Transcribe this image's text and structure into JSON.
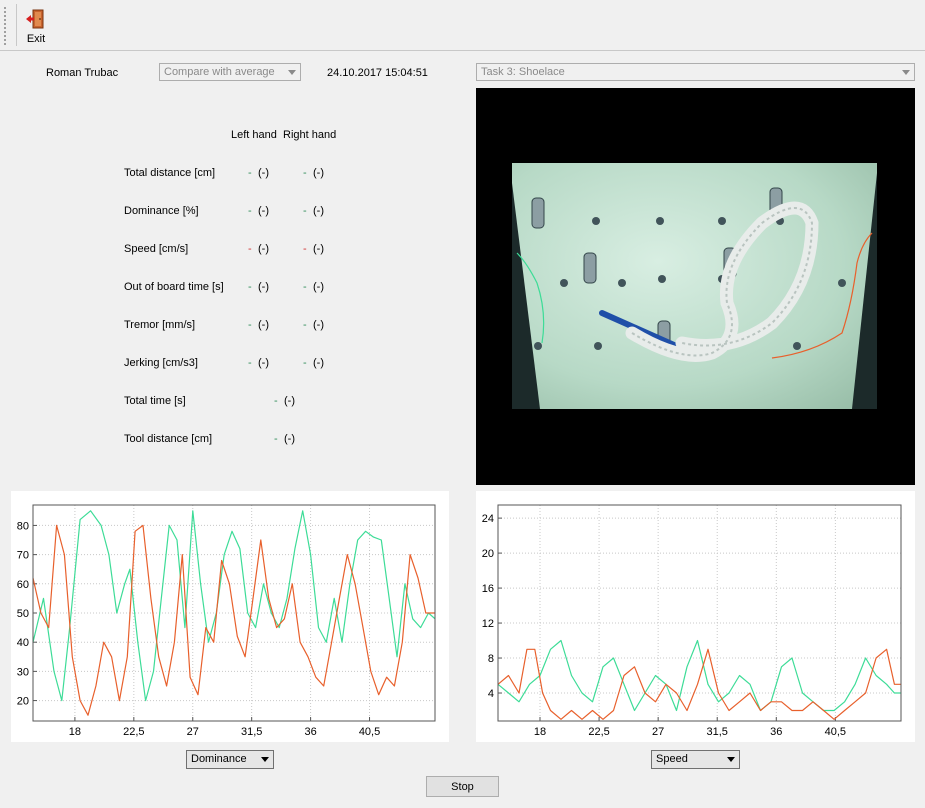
{
  "toolbar": {
    "exit_label": "Exit",
    "exit_icon": "exit-door-icon"
  },
  "header": {
    "user_name": "Roman Trubac",
    "compare_select": "Compare with average",
    "timestamp": "24.10.2017 15:04:51",
    "task_select": "Task 3: Shoelace"
  },
  "metrics": {
    "col_left": "Left hand",
    "col_right": "Right hand",
    "rows": [
      {
        "label": "Total distance [cm]",
        "left_dash": "-",
        "left_value": "(-)",
        "right_dash": "-",
        "right_value": "(-)"
      },
      {
        "label": "Dominance [%]",
        "left_dash": "-",
        "left_value": "(-)",
        "right_dash": "-",
        "right_value": "(-)"
      },
      {
        "label": "Speed [cm/s]",
        "left_dash": "-",
        "left_value": "(-)",
        "right_dash": "-",
        "right_value": "(-)"
      },
      {
        "label": "Out of board time [s]",
        "left_dash": "-",
        "left_value": "(-)",
        "right_dash": "-",
        "right_value": "(-)"
      },
      {
        "label": "Tremor [mm/s]",
        "left_dash": "-",
        "left_value": "(-)",
        "right_dash": "-",
        "right_value": "(-)"
      },
      {
        "label": "Jerking [cm/s3]",
        "left_dash": "-",
        "left_value": "(-)",
        "right_dash": "-",
        "right_value": "(-)"
      }
    ],
    "single_rows": [
      {
        "label": "Total time [s]",
        "dash": "-",
        "value": "(-)"
      },
      {
        "label": "Tool distance [cm]",
        "dash": "-",
        "value": "(-)"
      }
    ]
  },
  "colors": {
    "left_hand": "#3ddc97",
    "right_hand": "#e8602c"
  },
  "chart_data": [
    {
      "type": "line",
      "x_ticks": [
        "18",
        "22,5",
        "27",
        "31,5",
        "36",
        "40,5"
      ],
      "x_tick_values": [
        18,
        22.5,
        27,
        31.5,
        36,
        40.5
      ],
      "xlim": [
        14.8,
        45.5
      ],
      "y_ticks": [
        "20",
        "30",
        "40",
        "50",
        "60",
        "70",
        "80"
      ],
      "y_tick_values": [
        20,
        30,
        40,
        50,
        60,
        70,
        80
      ],
      "ylim": [
        13,
        87
      ],
      "grid": true,
      "series": [
        {
          "color": "#3ddc97",
          "x": [
            14.8,
            15.6,
            16.4,
            17.0,
            17.6,
            18.4,
            19.2,
            20.0,
            20.6,
            21.2,
            21.8,
            22.2,
            22.8,
            23.4,
            24.0,
            24.6,
            25.2,
            25.8,
            26.4,
            27.0,
            27.6,
            28.2,
            28.8,
            29.4,
            30.0,
            30.6,
            31.2,
            31.8,
            32.4,
            33.0,
            33.6,
            34.2,
            34.8,
            35.4,
            36.0,
            36.6,
            37.2,
            37.8,
            38.4,
            39.0,
            39.6,
            40.2,
            40.8,
            41.4,
            42.0,
            42.6,
            43.2,
            43.8,
            44.4,
            45.0,
            45.5
          ],
          "values": [
            40,
            55,
            30,
            20,
            45,
            82,
            85,
            80,
            70,
            50,
            60,
            65,
            40,
            20,
            30,
            55,
            80,
            75,
            45,
            85,
            60,
            40,
            50,
            70,
            78,
            72,
            50,
            45,
            60,
            50,
            45,
            55,
            72,
            85,
            70,
            45,
            40,
            55,
            40,
            60,
            75,
            78,
            76,
            75,
            55,
            35,
            60,
            48,
            45,
            50,
            48
          ]
        },
        {
          "color": "#e8602c",
          "x": [
            14.8,
            15.4,
            16.0,
            16.6,
            17.2,
            17.8,
            18.4,
            19.0,
            19.6,
            20.2,
            20.8,
            21.4,
            22.0,
            22.6,
            23.2,
            23.8,
            24.4,
            25.0,
            25.6,
            26.2,
            26.8,
            27.4,
            28.0,
            28.6,
            29.2,
            29.8,
            30.4,
            31.0,
            31.6,
            32.2,
            32.8,
            33.4,
            34.0,
            34.6,
            35.2,
            35.8,
            36.4,
            37.0,
            37.6,
            38.2,
            38.8,
            39.4,
            40.0,
            40.6,
            41.2,
            41.8,
            42.4,
            43.0,
            43.6,
            44.2,
            44.8,
            45.5
          ],
          "values": [
            62,
            50,
            45,
            80,
            70,
            35,
            20,
            15,
            25,
            40,
            35,
            20,
            35,
            78,
            80,
            55,
            35,
            25,
            40,
            70,
            28,
            22,
            45,
            40,
            68,
            60,
            42,
            35,
            55,
            75,
            55,
            45,
            48,
            60,
            40,
            35,
            28,
            25,
            40,
            55,
            70,
            60,
            45,
            30,
            22,
            28,
            25,
            40,
            70,
            62,
            50,
            50
          ]
        }
      ]
    },
    {
      "type": "line",
      "x_ticks": [
        "18",
        "22,5",
        "27",
        "31,5",
        "36",
        "40,5"
      ],
      "x_tick_values": [
        18,
        22.5,
        27,
        31.5,
        36,
        40.5
      ],
      "xlim": [
        14.8,
        45.5
      ],
      "y_ticks": [
        "4",
        "8",
        "12",
        "16",
        "20",
        "24"
      ],
      "y_tick_values": [
        4,
        8,
        12,
        16,
        20,
        24
      ],
      "ylim": [
        0.8,
        25.5
      ],
      "grid": true,
      "series": [
        {
          "color": "#3ddc97",
          "x": [
            14.8,
            15.6,
            16.4,
            17.2,
            18.0,
            18.8,
            19.6,
            20.4,
            21.2,
            22.0,
            22.8,
            23.6,
            24.4,
            25.2,
            26.0,
            26.8,
            27.6,
            28.4,
            29.2,
            30.0,
            30.8,
            31.6,
            32.4,
            33.2,
            34.0,
            34.8,
            35.6,
            36.4,
            37.2,
            38.0,
            38.8,
            39.6,
            40.4,
            41.2,
            42.0,
            42.8,
            43.6,
            44.4,
            45.0,
            45.5
          ],
          "values": [
            5,
            4,
            3,
            5,
            6,
            9,
            10,
            6,
            4,
            3,
            7,
            8,
            5,
            2,
            4,
            6,
            5,
            2,
            7,
            10,
            5,
            3,
            4,
            6,
            5,
            2,
            3,
            7,
            8,
            4,
            3,
            2,
            2,
            3,
            5,
            8,
            6,
            5,
            4,
            4
          ]
        },
        {
          "color": "#e8602c",
          "x": [
            14.8,
            15.6,
            16.4,
            17.0,
            17.6,
            18.2,
            18.8,
            19.6,
            20.4,
            21.2,
            22.0,
            22.8,
            23.6,
            24.4,
            25.2,
            26.0,
            26.8,
            27.6,
            28.4,
            29.2,
            30.0,
            30.8,
            31.6,
            32.4,
            33.2,
            34.0,
            34.8,
            35.6,
            36.4,
            37.2,
            38.0,
            38.8,
            39.6,
            40.4,
            41.2,
            42.0,
            42.8,
            43.6,
            44.4,
            45.0,
            45.5
          ],
          "values": [
            5,
            6,
            4,
            9,
            9,
            4,
            2,
            1,
            2,
            1,
            2,
            1,
            2,
            6,
            7,
            4,
            3,
            5,
            4,
            2,
            5,
            9,
            4,
            2,
            3,
            4,
            2,
            3,
            3,
            2,
            2,
            3,
            2,
            1,
            2,
            3,
            4,
            8,
            9,
            5,
            5
          ]
        }
      ]
    }
  ],
  "chart_selects": {
    "left": "Dominance",
    "right": "Speed"
  },
  "stop_button": "Stop"
}
